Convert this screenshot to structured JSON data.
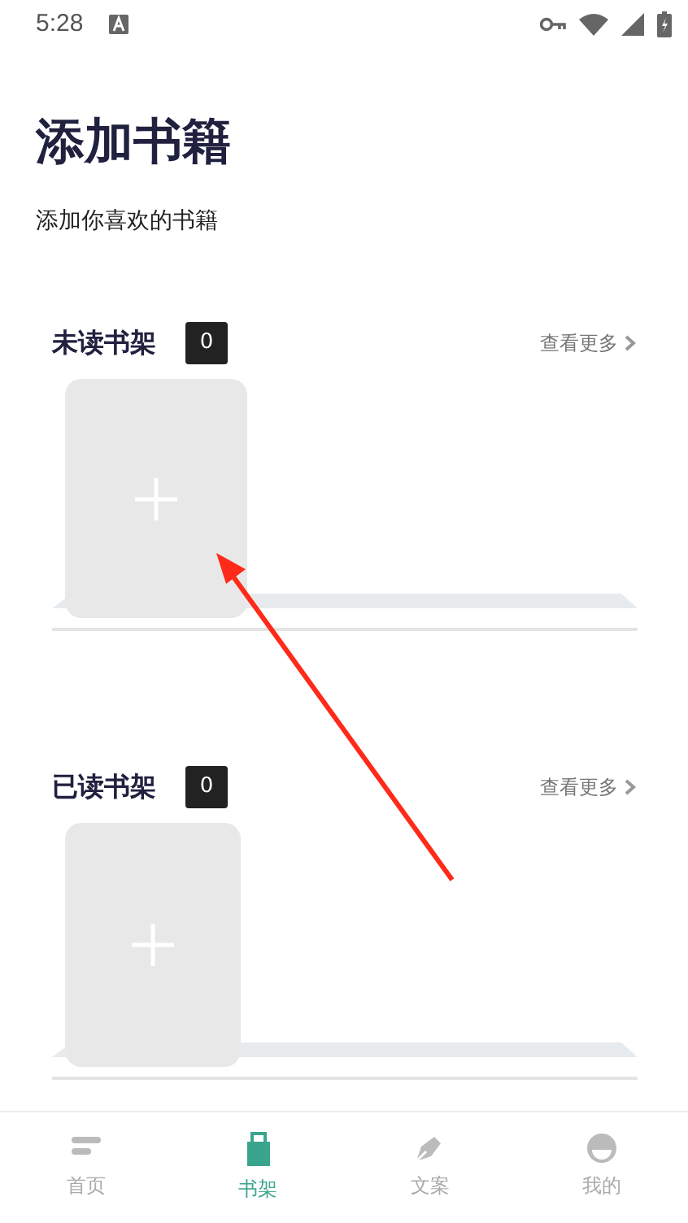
{
  "status_bar": {
    "time": "5:28"
  },
  "header": {
    "title": "添加书籍",
    "subtitle": "添加你喜欢的书籍"
  },
  "shelves": [
    {
      "title": "未读书架",
      "count": "0",
      "more": "查看更多"
    },
    {
      "title": "已读书架",
      "count": "0",
      "more": "查看更多"
    }
  ],
  "annotation": {
    "kind": "arrow",
    "color": "#ff2a1a"
  },
  "bottom_nav": [
    {
      "label": "首页",
      "kind": "home",
      "selected": false
    },
    {
      "label": "书架",
      "kind": "shelf",
      "selected": true
    },
    {
      "label": "文案",
      "kind": "pen",
      "selected": false
    },
    {
      "label": "我的",
      "kind": "person",
      "selected": false
    }
  ]
}
